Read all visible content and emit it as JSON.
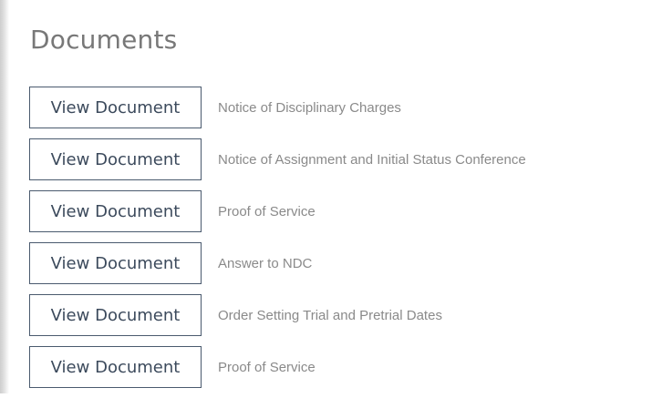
{
  "documents_section": {
    "title": "Documents",
    "items": [
      {
        "button_label": "View Document",
        "name": "Notice of Disciplinary Charges"
      },
      {
        "button_label": "View Document",
        "name": "Notice of Assignment and Initial Status Conference"
      },
      {
        "button_label": "View Document",
        "name": "Proof of Service"
      },
      {
        "button_label": "View Document",
        "name": "Answer to NDC"
      },
      {
        "button_label": "View Document",
        "name": "Order Setting Trial and Pretrial Dates"
      },
      {
        "button_label": "View Document",
        "name": "Proof of Service"
      }
    ]
  }
}
